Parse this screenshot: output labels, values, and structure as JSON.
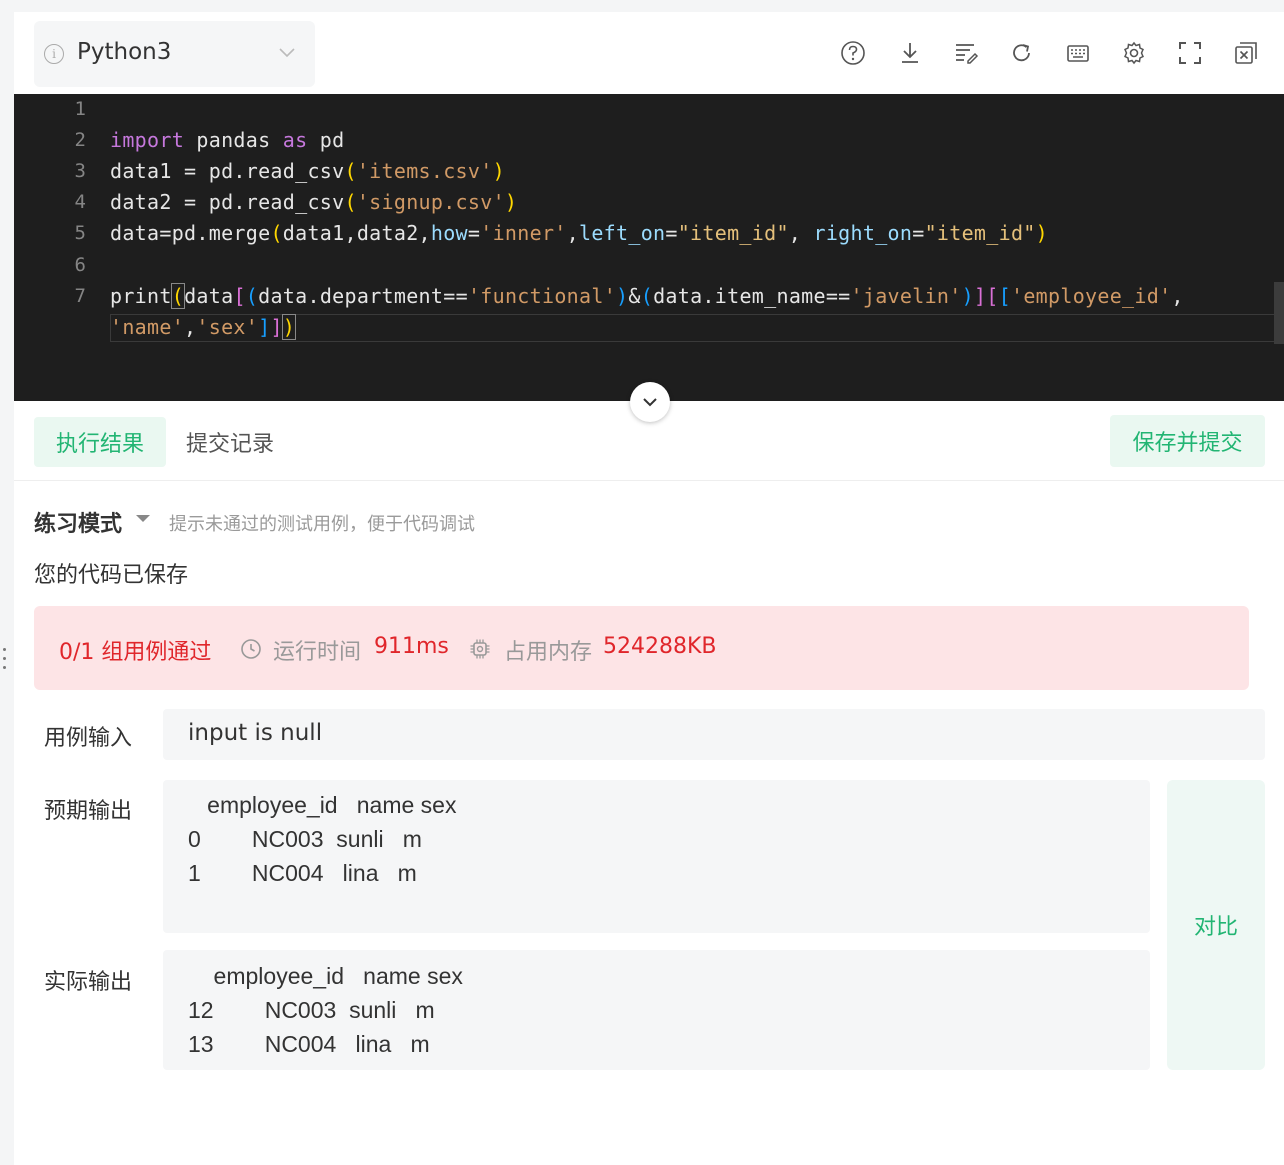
{
  "toolbar": {
    "language": "Python3",
    "icons": [
      "help-icon",
      "download-icon",
      "format-icon",
      "reset-icon",
      "keyboard-icon",
      "settings-icon",
      "fullscreen-icon",
      "close-panel-icon"
    ]
  },
  "editor": {
    "line_numbers": [
      "1",
      "2",
      "3",
      "4",
      "5",
      "6",
      "7"
    ]
  },
  "tabs": {
    "active": "执行结果",
    "second": "提交记录",
    "submit_button": "保存并提交"
  },
  "result": {
    "mode_label": "练习模式",
    "mode_hint": "提示未通过的测试用例，便于代码调试",
    "saved_message": "您的代码已保存",
    "status": {
      "pass_text": "0/1 组用例通过",
      "time_label": "运行时间",
      "time_value": "911ms",
      "memory_label": "占用内存",
      "memory_value": "524288KB"
    },
    "input_label": "用例输入",
    "input_value": "input is null",
    "expected_label": "预期输出",
    "expected_lines": [
      "   employee_id   name sex",
      "0        NC003  sunli   m",
      "1        NC004   lina   m"
    ],
    "actual_label": "实际输出",
    "actual_lines": [
      "    employee_id   name sex",
      "12        NC003  sunli   m",
      "13        NC004   lina   m"
    ],
    "compare_button": "对比"
  },
  "colors": {
    "accent_green": "#22b573",
    "error_red": "#e0262b",
    "error_bg": "#fde4e6",
    "editor_bg": "#1e1e1e"
  }
}
